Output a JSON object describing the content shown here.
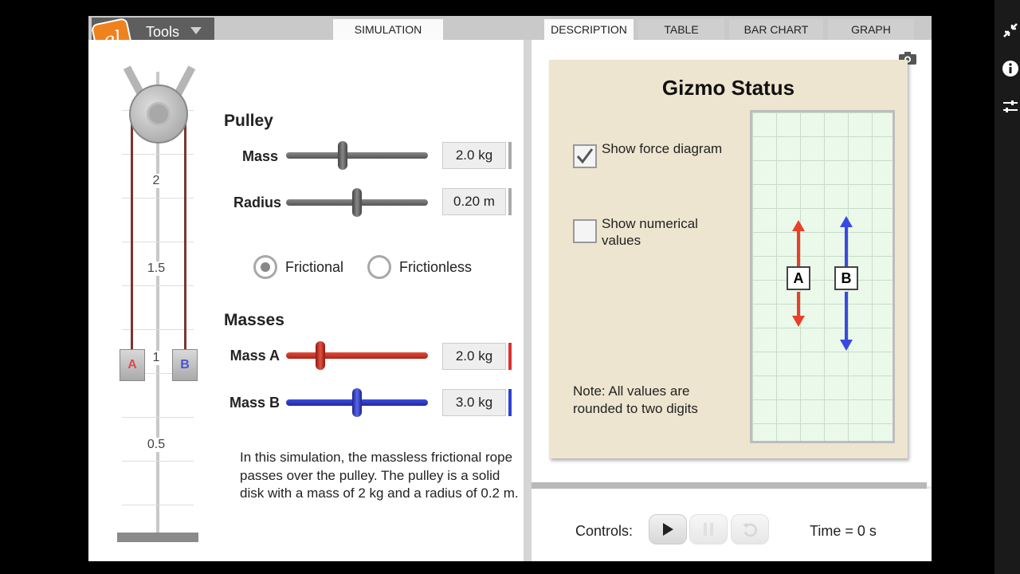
{
  "tools": {
    "logo": "el",
    "label": "Tools"
  },
  "tabs": {
    "simulation": "SIMULATION",
    "description": "DESCRIPTION",
    "table": "TABLE",
    "bar_chart": "BAR CHART",
    "graph": "GRAPH"
  },
  "ruler": {
    "labels": [
      "2",
      "1.5",
      "1",
      "0.5"
    ]
  },
  "blocks": {
    "a": "A",
    "b": "B"
  },
  "pulley": {
    "title": "Pulley",
    "mass_label": "Mass",
    "mass_value": "2.0 kg",
    "mass_fraction": 0.4,
    "radius_label": "Radius",
    "radius_value": "0.20 m",
    "radius_fraction": 0.5
  },
  "friction": {
    "frictional": "Frictional",
    "frictionless": "Frictionless",
    "selected": "Frictional"
  },
  "masses": {
    "title": "Masses",
    "a_label": "Mass A",
    "a_value": "2.0 kg",
    "a_fraction": 0.24,
    "b_label": "Mass B",
    "b_value": "3.0 kg",
    "b_fraction": 0.5
  },
  "description": "In this simulation, the massless frictional rope passes over the pulley. The pulley is a solid disk with a mass of 2 kg and a radius of 0.2 m.",
  "status": {
    "title": "Gizmo Status",
    "show_force_label": "Show force diagram",
    "show_force_checked": true,
    "show_numerical_label": "Show numerical values",
    "show_numerical_checked": false,
    "note": "Note: All values are rounded to two digits",
    "label_a": "A",
    "label_b": "B",
    "color_a": "#e8402a",
    "color_b": "#3a4ae0"
  },
  "controls": {
    "label": "Controls:",
    "time": "Time = 0 s"
  },
  "icons": {
    "rail": [
      "collapse-icon",
      "info-icon",
      "settings-icon"
    ],
    "camera": "camera-icon"
  }
}
